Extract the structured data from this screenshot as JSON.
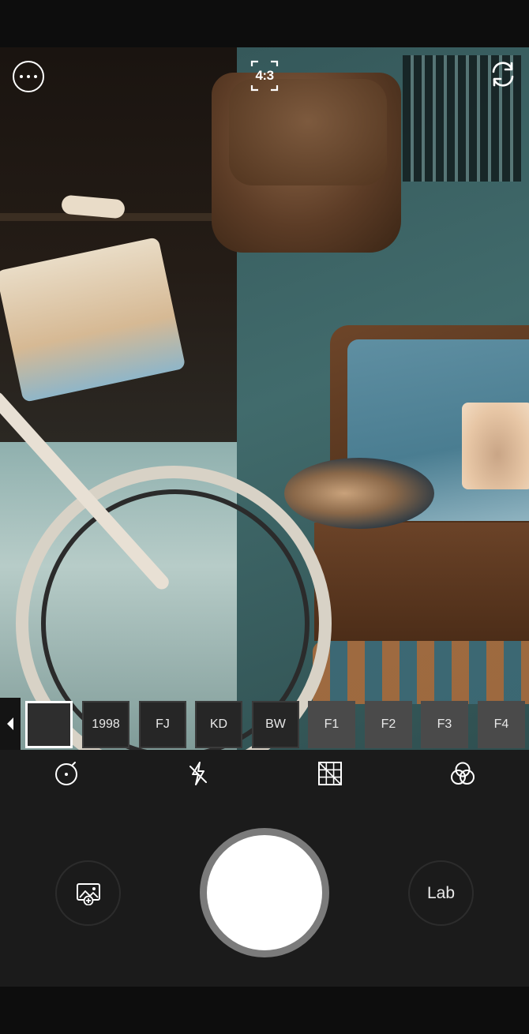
{
  "top_bar": {
    "more_icon": "more-horizontal-icon",
    "ratio_label": "4:3",
    "flip_icon": "camera-flip-icon"
  },
  "filters": {
    "prev_icon": "triangle-left-icon",
    "items": [
      {
        "label": "",
        "selected": true
      },
      {
        "label": "1998"
      },
      {
        "label": "FJ"
      },
      {
        "label": "KD"
      },
      {
        "label": "BW"
      },
      {
        "label": "F1"
      },
      {
        "label": "F2"
      },
      {
        "label": "F3"
      },
      {
        "label": "F4"
      }
    ]
  },
  "tools": {
    "timer_icon": "timer-icon",
    "flash_icon": "flash-off-icon",
    "grid_icon": "grid-icon",
    "filter_icon": "color-filter-icon"
  },
  "bottom": {
    "gallery_icon": "gallery-add-icon",
    "shutter": "shutter-button",
    "lab_label": "Lab"
  },
  "colors": {
    "panel_bg": "#1b1b1b",
    "shutter": "#ffffff",
    "shutter_ring": "#7b7b7b"
  }
}
